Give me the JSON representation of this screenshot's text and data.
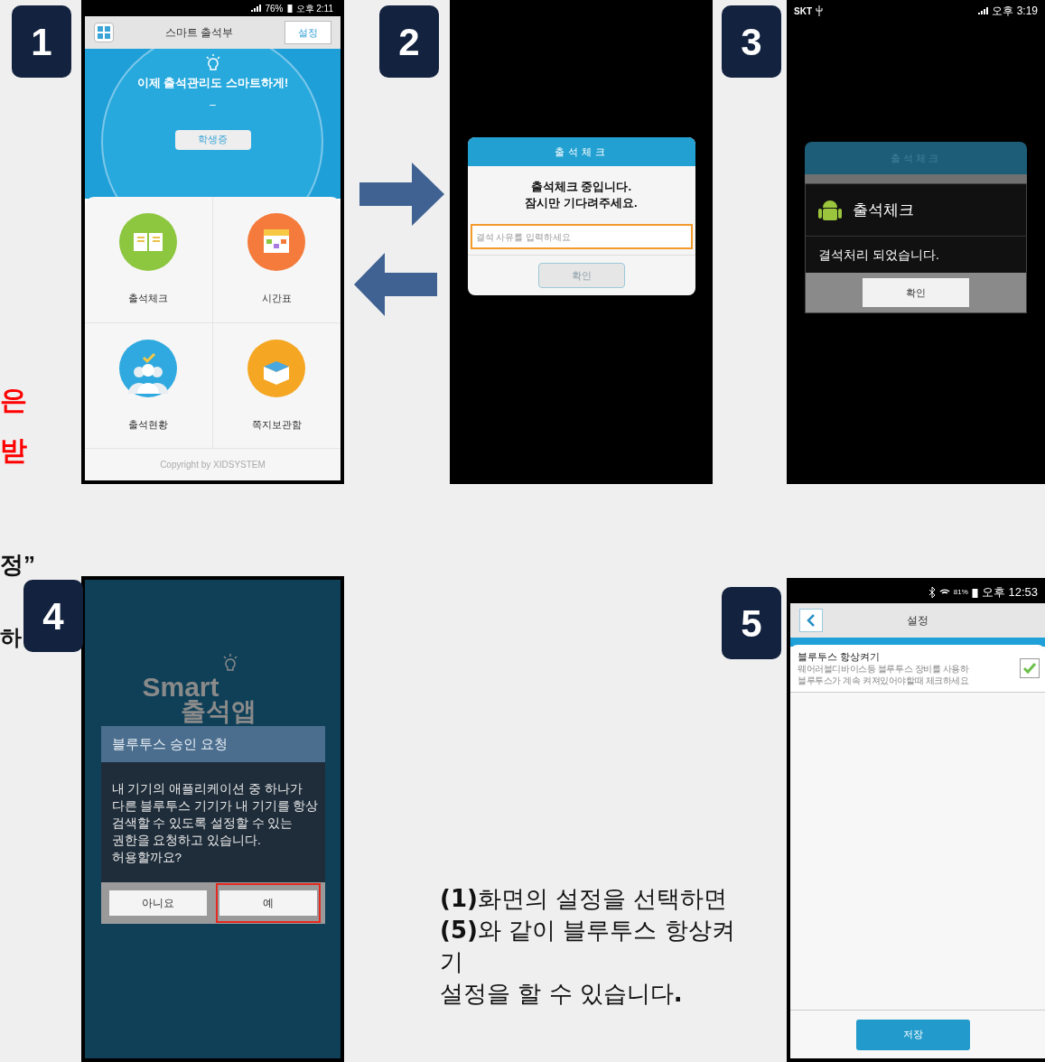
{
  "edge_fragments": [
    {
      "text": "은",
      "color": "#ff0000"
    },
    {
      "text": "받",
      "color": "#ff0000"
    },
    {
      "text": "정”",
      "color": "#111111"
    },
    {
      "text": "하",
      "color": "#111111"
    }
  ],
  "screen_1": {
    "badge": "1",
    "status": {
      "battery": "76%",
      "time": "오후 2:11"
    },
    "header": {
      "title": "스마트 출석부",
      "settings_button": "설정"
    },
    "hero": {
      "headline": "이제 출석관리도 스마트하게!",
      "dash": "–",
      "button": "학생증"
    },
    "menu": [
      {
        "label": "출석체크",
        "kind": "book"
      },
      {
        "label": "시간표",
        "kind": "calendar"
      },
      {
        "label": "출석현황",
        "kind": "people"
      },
      {
        "label": "쪽지보관함",
        "kind": "box"
      }
    ],
    "footer": "Copyright by XIDSYSTEM"
  },
  "arrows": [
    {
      "kind": "right"
    },
    {
      "kind": "left"
    }
  ],
  "screen_2": {
    "badge": "2",
    "dialog": {
      "title": "출석체크",
      "message": [
        "출석체크 중입니다.",
        "잠시만 기다려주세요."
      ],
      "placeholder": "결석 사유를 입력하세요",
      "button": "확인"
    }
  },
  "screen_3": {
    "badge": "3",
    "status": {
      "carrier": "SKT",
      "time": "오후 3:19"
    },
    "background_dialog": {
      "title": "출석체크"
    },
    "dialog": {
      "title": "출석체크",
      "message": "결석처리 되었습니다.",
      "button": "확인"
    }
  },
  "screen_4": {
    "badge": "4",
    "logo": [
      "Smart",
      "출석앱"
    ],
    "dialog": {
      "title": "블루투스 승인 요청",
      "message": [
        "내 기기의 애플리케이션 중 하나가",
        "다른 블루투스 기기가 내 기기를 항상",
        "검색할 수 있도록 설정할 수 있는",
        "권한을 요청하고 있습니다.",
        "허용할까요?"
      ],
      "buttons": [
        {
          "label": "아니요",
          "highlighted": false
        },
        {
          "label": "예",
          "highlighted": true
        }
      ]
    }
  },
  "caption": {
    "lines": [
      "**(1)**화면의 설정을 선택하면",
      "**(5)**와 같이 블루투스 항상켜",
      "기",
      "설정을 할 수 있습니다**.**"
    ]
  },
  "screen_5": {
    "badge": "5",
    "status": {
      "battery": "81%",
      "time": "오후 12:53"
    },
    "header": {
      "title": "설정"
    },
    "setting": {
      "title": "블루투스 항상켜기",
      "description": [
        "웨어러블디바이스등 블루투스 장비를 사용하",
        "블루투스가 계속 켜져있어야할때 체크하세요"
      ],
      "checked": true
    },
    "save_button": "저장"
  }
}
